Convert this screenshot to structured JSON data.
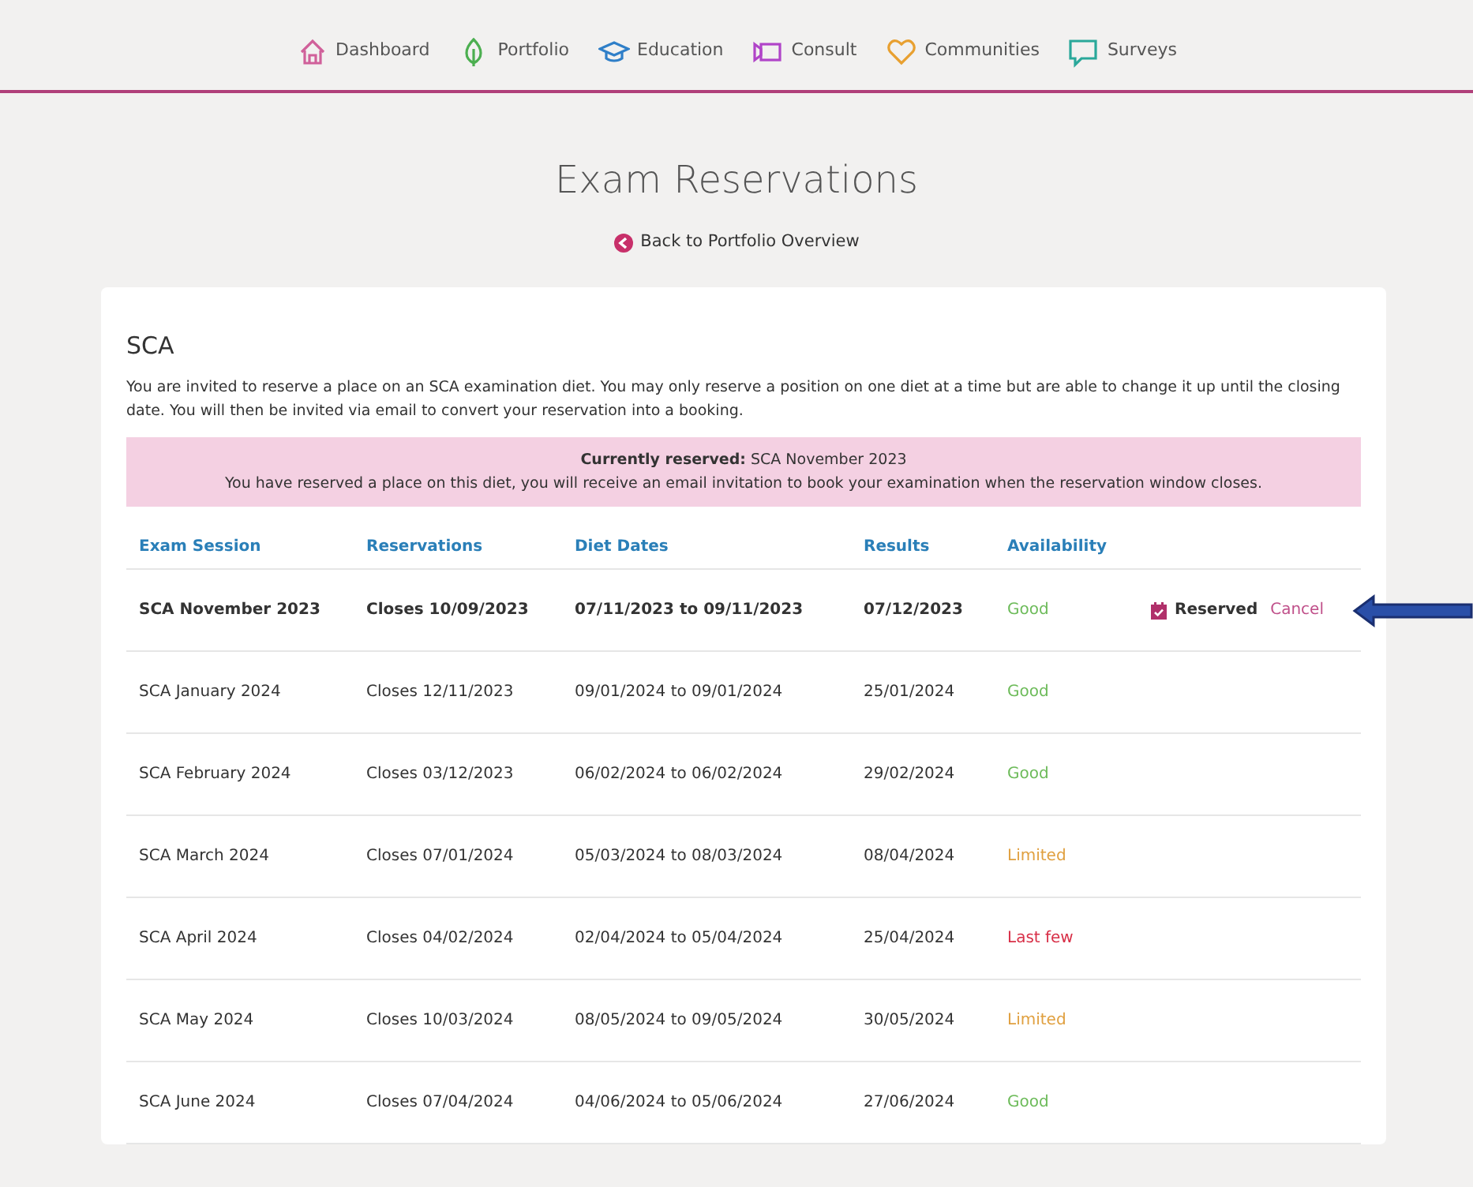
{
  "nav": [
    {
      "label": "Dashboard",
      "color": "#d0609a"
    },
    {
      "label": "Portfolio",
      "color": "#4caf50"
    },
    {
      "label": "Education",
      "color": "#2f7fc8"
    },
    {
      "label": "Consult",
      "color": "#b044c8"
    },
    {
      "label": "Communities",
      "color": "#e8a030"
    },
    {
      "label": "Surveys",
      "color": "#2aa89a"
    }
  ],
  "title": "Exam Reservations",
  "back_link": "Back to Portfolio Overview",
  "section": {
    "heading": "SCA",
    "intro": "You are invited to reserve a place on an SCA examination diet. You may only reserve a position on one diet at a time but are able to change it up until the closing date. You will then be invited via email to convert your reservation into a booking.",
    "alert": {
      "line1": "**Currently reserved:** SCA November 2023",
      "line2": "You have reserved a place on this diet, you will receive an email invitation to book your examination when the reservation window closes."
    }
  },
  "table": {
    "columns": [
      "Exam Session",
      "Reservations",
      "Diet Dates",
      "Results",
      "Availability"
    ],
    "rows": [
      {
        "session": "SCA November 2023",
        "reservations": "Closes 10/09/2023",
        "dates": "07/11/2023 to 09/11/2023",
        "results": "07/12/2023",
        "availability": "Good",
        "color": "#6dbb5a",
        "reserved": true,
        "status": "Reserved",
        "action": "Cancel"
      },
      {
        "session": "SCA January 2024",
        "reservations": "Closes 12/11/2023",
        "dates": "09/01/2024 to 09/01/2024",
        "results": "25/01/2024",
        "availability": "Good",
        "color": "#6dbb5a",
        "reserved": false
      },
      {
        "session": "SCA February 2024",
        "reservations": "Closes 03/12/2023",
        "dates": "06/02/2024 to 06/02/2024",
        "results": "29/02/2024",
        "availability": "Good",
        "color": "#6dbb5a",
        "reserved": false
      },
      {
        "session": "SCA March 2024",
        "reservations": "Closes 07/01/2024",
        "dates": "05/03/2024 to 08/03/2024",
        "results": "08/04/2024",
        "availability": "Limited",
        "color": "#e0a040",
        "reserved": false
      },
      {
        "session": "SCA April 2024",
        "reservations": "Closes 04/02/2024",
        "dates": "02/04/2024 to 05/04/2024",
        "results": "25/04/2024",
        "availability": "Last few",
        "color": "#d83048",
        "reserved": false
      },
      {
        "session": "SCA May 2024",
        "reservations": "Closes 10/03/2024",
        "dates": "08/05/2024 to 09/05/2024",
        "results": "30/05/2024",
        "availability": "Limited",
        "color": "#e0a040",
        "reserved": false
      },
      {
        "session": "SCA June 2024",
        "reservations": "Closes 07/04/2024",
        "dates": "04/06/2024 to 05/06/2024",
        "results": "27/06/2024",
        "availability": "Good",
        "color": "#6dbb5a",
        "reserved": false
      }
    ]
  },
  "annotation": {
    "kind": "arrow"
  }
}
